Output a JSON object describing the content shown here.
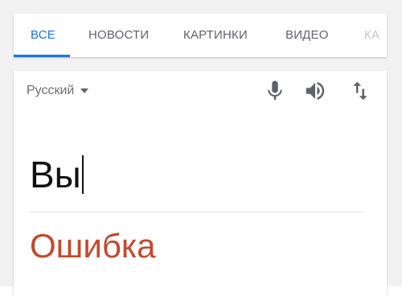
{
  "tabs": [
    {
      "label": "ВСЕ",
      "active": true
    },
    {
      "label": "НОВОСТИ",
      "active": false
    },
    {
      "label": "КАРТИНКИ",
      "active": false
    },
    {
      "label": "ВИДЕО",
      "active": false
    },
    {
      "label": "КА",
      "active": false
    }
  ],
  "translator": {
    "source_language": "Русский",
    "source_text": "Вы",
    "result_text": "Ошибка",
    "icons": [
      "microphone-icon",
      "speaker-icon",
      "swap-languages-icon"
    ]
  },
  "colors": {
    "accent": "#1a73e8",
    "tab_text": "#5f6368",
    "result_text": "#c4482c"
  }
}
